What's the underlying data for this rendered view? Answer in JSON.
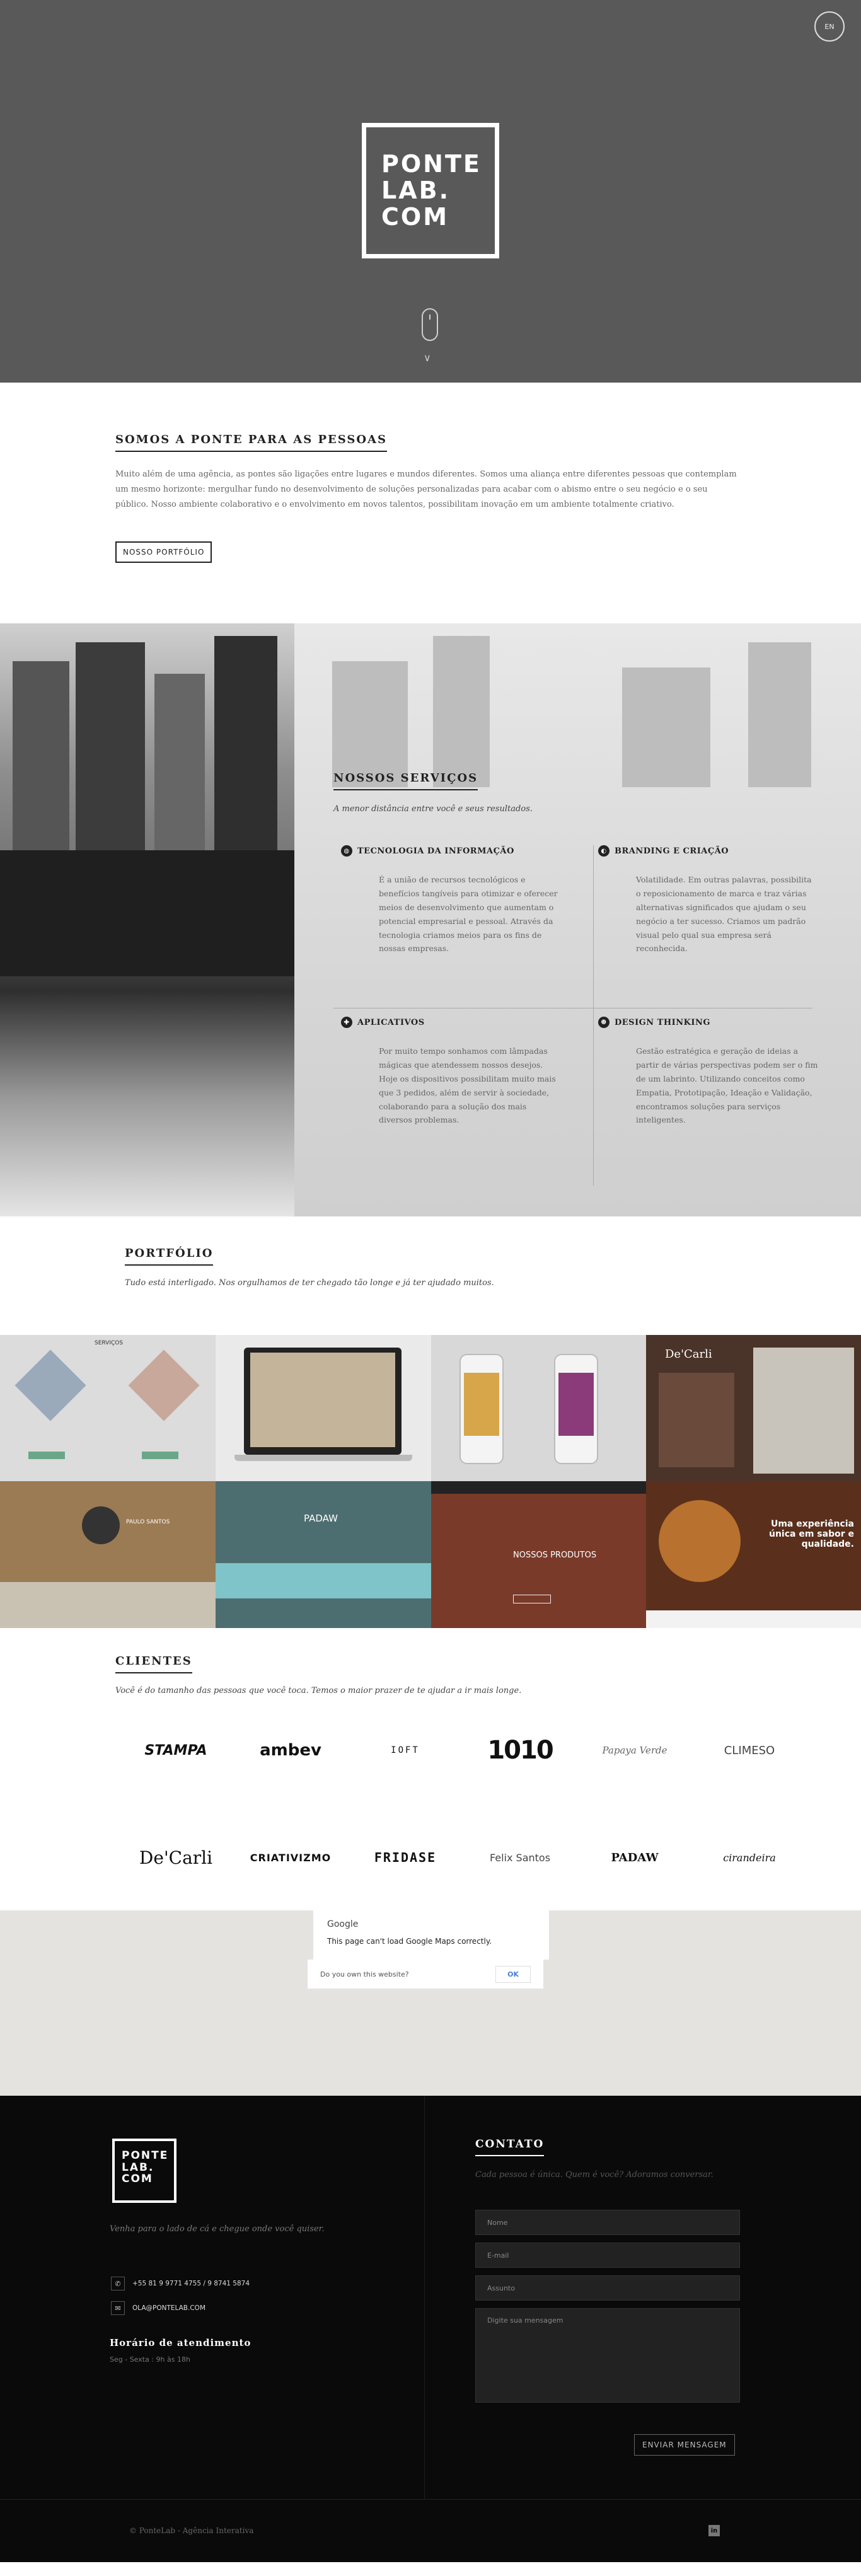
{
  "hero": {
    "lang": "EN",
    "logo_lines": [
      "PONTE",
      "LAB.",
      "COM"
    ],
    "scroll_chevron": "∨"
  },
  "about": {
    "title_pre": "SOMOS A ",
    "title_bold": "PONTE",
    "title_post": " PARA AS PESSOAS",
    "text": "Muito além de uma agência, as pontes são ligações entre lugares e mundos diferentes. Somos uma aliança entre diferentes pessoas que contemplam um mesmo horizonte: mergulhar fundo no desenvolvimento de soluções personalizadas para acabar com o abismo entre o seu negócio e o seu público. Nosso ambiente colaborativo e o envolvimento em novos talentos, possibilitam inovação em um ambiente totalmente criativo.",
    "button": "NOSSO PORTFÓLIO"
  },
  "services": {
    "title": "NOSSOS SERVIÇOS",
    "subtitle": "A menor distância entre você e seus resultados.",
    "items": [
      {
        "icon": "globe-icon",
        "title": "TECNOLOGIA DA INFORMAÇÃO",
        "text": "É a união de recursos tecnológicos e benefícios tangíveis para otimizar e oferecer meios de desenvolvimento que aumentam o potencial empresarial e pessoal. Através da tecnologia criamos meios para os fins de nossas empresas."
      },
      {
        "icon": "drop-icon",
        "title": "BRANDING E CRIAÇÃO",
        "text": "Volatilidade. Em outras palavras, possibilita o reposicionamento de marca e traz várias alternativas significados que ajudam o seu negócio a ter sucesso. Criamos um padrão visual pelo qual sua empresa será reconhecida."
      },
      {
        "icon": "puzzle-icon",
        "title": "APLICATIVOS",
        "text": "Por muito tempo sonhamos com lâmpadas mágicas que atendessem nossos desejos. Hoje os dispositivos possibilitam muito mais que 3 pedidos, além de servir à sociedade, colaborando para a solução dos mais diversos problemas."
      },
      {
        "icon": "head-icon",
        "title": "DESIGN THINKING",
        "text": "Gestão estratégica e geração de ideias a partir de várias perspectivas podem ser o fim de um labrinto. Utilizando conceitos como Empatia, Prototipação, Ideação e Validação, encontramos soluções para serviços inteligentes."
      }
    ]
  },
  "portfolio": {
    "title": "PORTFÓLIO",
    "subtitle": "Tudo está interligado. Nos orgulhamos de ter chegado tão longe e já ter ajudado muitos.",
    "tiles": [
      {
        "caption": "SERVIÇOS"
      },
      {
        "caption": ""
      },
      {
        "caption": ""
      },
      {
        "caption": "De'Carli"
      },
      {
        "caption": "PAULO SANTOS"
      },
      {
        "caption": "PADAW"
      },
      {
        "caption": "NOSSOS PRODUTOS"
      },
      {
        "caption": "Uma experiência única em sabor e qualidade."
      }
    ]
  },
  "clients": {
    "title": "CLIENTES",
    "subtitle": "Você é do tamanho das pessoas que você toca. Temos o maior prazer de te ajudar a ir mais longe.",
    "logos": [
      "STAMPA",
      "ambev",
      "IOFT",
      "1010",
      "Papaya Verde",
      "CLIMESO",
      "De'Carli",
      "CRIATIVIZMO",
      "FRIDASE",
      "Felix Santos",
      "PADAW",
      "cirandeira"
    ]
  },
  "map": {
    "brand": "Google",
    "error": "This page can't load Google Maps correctly.",
    "question": "Do you own this website?",
    "ok": "OK"
  },
  "footer": {
    "logo_lines": [
      "PONTE",
      "LAB.",
      "COM"
    ],
    "tagline": "Venha para o lado de cá e chegue onde você quiser.",
    "phone": "+55 81 9 9771 4755   /   9 8741 5874",
    "email": "OLA@PONTELAB.COM",
    "hours_title": "Horário de atendimento",
    "hours": "Seg - Sexta : 9h às 18h",
    "contact_title": "CONTATO",
    "contact_sub": "Cada pessoa é única. Quem é você? Adoramos conversar.",
    "placeholders": {
      "name": "Nome",
      "email": "E-mail",
      "subject": "Assunto",
      "message": "Digite sua mensagem"
    },
    "send": "ENVIAR MENSAGEM",
    "copyright": "© PonteLab - Agência Interativa",
    "linkedin": "in"
  }
}
